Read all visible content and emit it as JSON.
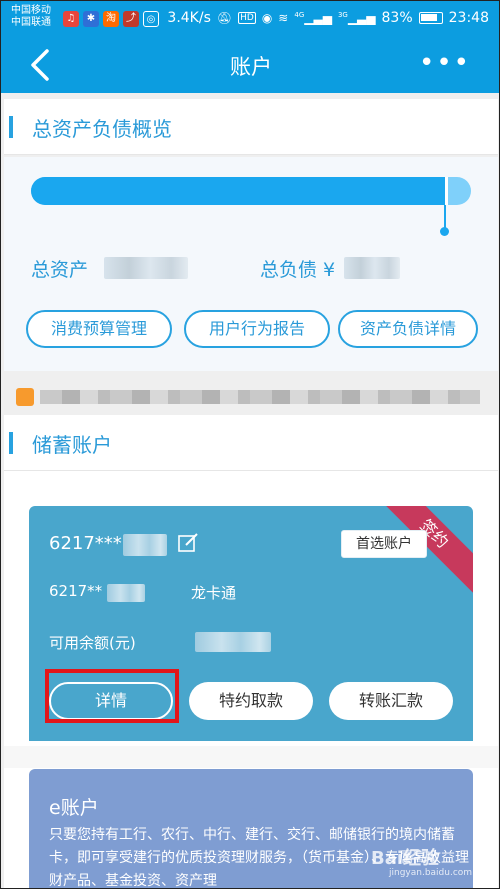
{
  "status_bar": {
    "carrier_1": "中国移动",
    "carrier_2": "中国联通",
    "net_speed": "3.4K/s",
    "hd": "HD",
    "network_1": "4G",
    "network_2": "3G",
    "battery": "83%",
    "time": "23:48",
    "app_icons": [
      "music-app-icon",
      "baidu-app-icon",
      "taobao-app-icon",
      "stock-app-icon",
      "wifi-share-icon"
    ]
  },
  "header": {
    "title": "账户",
    "more": "•••"
  },
  "overview": {
    "section_title": "总资产负债概览",
    "assets_label": "总资产",
    "liabilities_label": "总负债 ¥",
    "assets_fraction": 0.94,
    "buttons": [
      "消费预算管理",
      "用户行为报告",
      "资产负债详情"
    ]
  },
  "savings": {
    "section_title": "储蓄账户",
    "card": {
      "ribbon": "签约",
      "account_main": "6217***",
      "preferred_label": "首选账户",
      "account_sub": "6217**",
      "card_type": "龙卡通",
      "balance_label": "可用余额(元)",
      "buttons": [
        "详情",
        "特约取款",
        "转账汇款"
      ]
    }
  },
  "e_account": {
    "title": "e账户",
    "description": "只要您持有工行、农行、中行、建行、交行、邮储银行的境内储蓄卡，即可享受建行的优质投资理财服务，（货币基金）、专属高收益理财产品、基金投资、资产理"
  },
  "watermark": {
    "brand": "Bai经验",
    "url": "jingyan.baidu.com"
  },
  "colors": {
    "primary_blue": "#0c9de0",
    "card_blue": "#49a6cc",
    "ribbon_red": "#c7395c",
    "e_card_blue": "#7f9dd2",
    "highlight_red": "#e2161a"
  }
}
